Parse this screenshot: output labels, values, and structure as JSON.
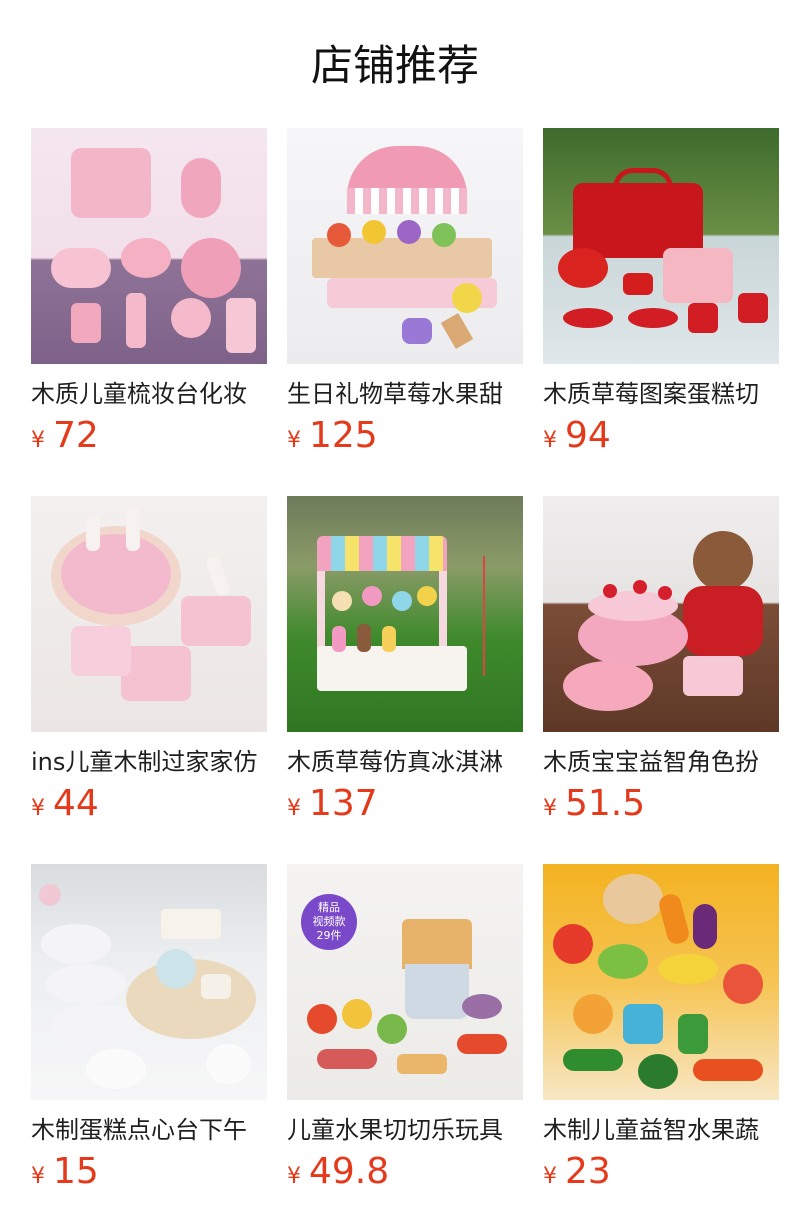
{
  "section": {
    "title": "店铺推荐"
  },
  "products": [
    {
      "name": "木质儿童梳妆台化妆",
      "currency": "¥",
      "price": "72",
      "image": "pink-vanity-makeup-toy-set"
    },
    {
      "name": "生日礼物草莓水果甜",
      "currency": "¥",
      "price": "125",
      "image": "strawberry-fruit-cart-toy"
    },
    {
      "name": "木质草莓图案蛋糕切",
      "currency": "¥",
      "price": "94",
      "image": "strawberry-cake-tea-set"
    },
    {
      "name": "ins儿童木制过家家仿",
      "currency": "¥",
      "price": "44",
      "image": "pink-cake-slices"
    },
    {
      "name": "木质草莓仿真冰淇淋",
      "currency": "¥",
      "price": "137",
      "image": "ice-cream-shop-cart"
    },
    {
      "name": "木质宝宝益智角色扮",
      "currency": "¥",
      "price": "51.5",
      "image": "birthday-cake-with-plush-moose"
    },
    {
      "name": "木制蛋糕点心台下午",
      "currency": "¥",
      "price": "15",
      "image": "afternoon-tea-dessert-stand"
    },
    {
      "name": "儿童水果切切乐玩具",
      "currency": "¥",
      "price": "49.8",
      "image": "fruit-cutting-set-with-bucket",
      "badge": [
        "精品",
        "视频款",
        "29件"
      ]
    },
    {
      "name": "木制儿童益智水果蔬",
      "currency": "¥",
      "price": "23",
      "image": "fruit-vegetable-cutting-set"
    }
  ]
}
